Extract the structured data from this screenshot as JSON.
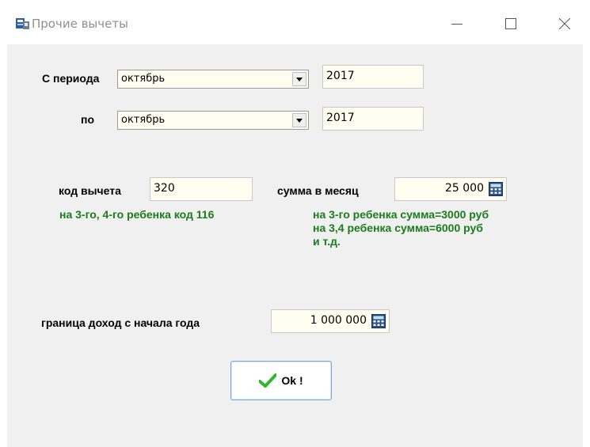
{
  "window": {
    "title": "Прочие вычеты",
    "icon": "app-window-icon",
    "controls": [
      "minimize-icon",
      "maximize-icon",
      "close-icon"
    ]
  },
  "period": {
    "from_label": "С периода",
    "from_month": "октябрь",
    "from_year": "2017",
    "to_label": "по",
    "to_month": "октябрь",
    "to_year": "2017"
  },
  "deduction": {
    "code_label": "код вычета",
    "code_value": "320",
    "amount_label": "сумма в месяц",
    "amount_value": "25 000",
    "code_hint": "на 3-го, 4-го ребенка код 116",
    "amount_hint": [
      "на 3-го ребенка сумма=3000 руб",
      "на 3,4 ребенка сумма=6000 руб",
      "и т.д."
    ]
  },
  "income_limit": {
    "label": "граница доход с начала года",
    "value": "1 000 000"
  },
  "ok_button": {
    "label": "Ok !",
    "icon": "checkmark-icon"
  },
  "colors": {
    "hint_green": "#1b7b1b",
    "field_bg": "#fffef0",
    "client_bg": "#f0f0f0"
  }
}
